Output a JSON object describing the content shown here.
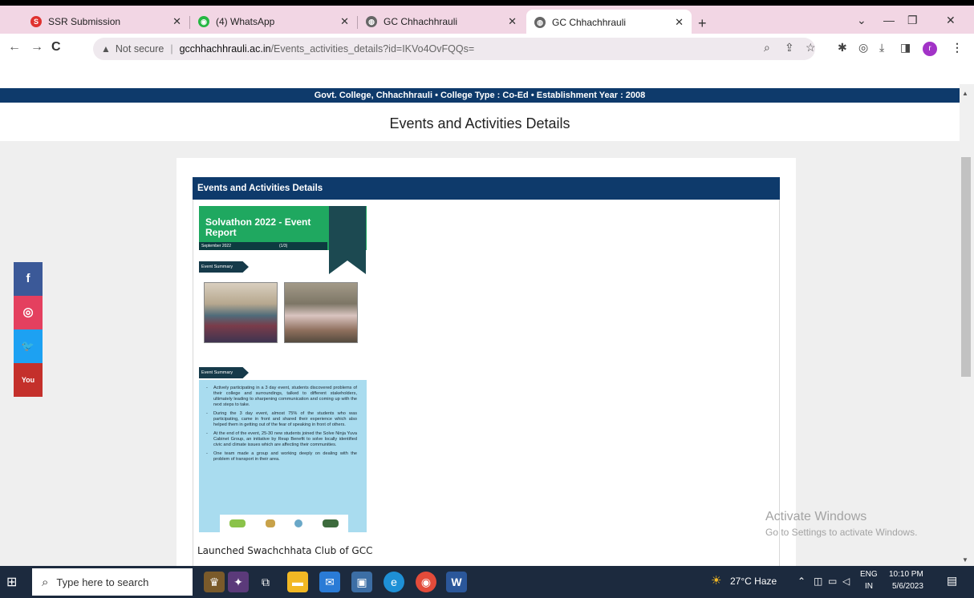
{
  "browser": {
    "tabs": [
      {
        "title": "SSR Submission",
        "favicon": "ssr-icon",
        "active": false
      },
      {
        "title": "(4) WhatsApp",
        "favicon": "whatsapp-icon",
        "active": false
      },
      {
        "title": "GC Chhachhrauli",
        "favicon": "globe-icon",
        "active": false
      },
      {
        "title": "GC Chhachhrauli",
        "favicon": "globe-icon",
        "active": true
      }
    ],
    "new_tab": "+",
    "address": {
      "security": "Not secure",
      "host": "gcchhachhrauli.ac.in",
      "path": "/Events_activities_details?id=IKVo4OvFQQs="
    },
    "profile_initial": "r"
  },
  "site": {
    "infobar": "Govt. College, Chhachhrauli  •  College Type : Co-Ed  •  Establishment Year : 2008",
    "page_title": "Events and Activities Details",
    "card_title": "Events and Activities Details",
    "report": {
      "title": "Solvathon 2022 - Event Report",
      "date": "September 2022",
      "page": "(1/3)",
      "tag1": "Event Summary",
      "tag2": "Event Summary",
      "points": [
        "Actively participating in a 3 day event, students discovered problems of their college and surroundings, talked to different stakeholders, ultimately leading to sharpening communication and coming up with the next steps to take.",
        "During the 3 day event, almost 75% of the students who was participating, came in front and shared their experience which also helped them in getting out of the fear of speaking in front of others.",
        "At the end of the event, 25-30 new students joined the Solve Ninja Yuva Cabinet Group, an initiative by Reap Benefit to solve locally identified civic and climate issues which are affecting their communities.",
        "One team made a group and working deeply on dealing with the problem of transport in their area."
      ]
    },
    "caption": "Launched Swachchhata Club of GCC"
  },
  "social": [
    {
      "label": "f",
      "color": "#3b5998"
    },
    {
      "label": "◎",
      "color": "#e4405f"
    },
    {
      "label": "🐦",
      "color": "#1da1f2"
    },
    {
      "label": "You",
      "color": "#c4302b"
    }
  ],
  "watermark": {
    "line1": "Activate Windows",
    "line2": "Go to Settings to activate Windows."
  },
  "taskbar": {
    "search_placeholder": "Type here to search",
    "weather": "27°C  Haze",
    "lang1": "ENG",
    "lang2": "IN",
    "time": "10:10 PM",
    "date": "5/6/2023"
  }
}
